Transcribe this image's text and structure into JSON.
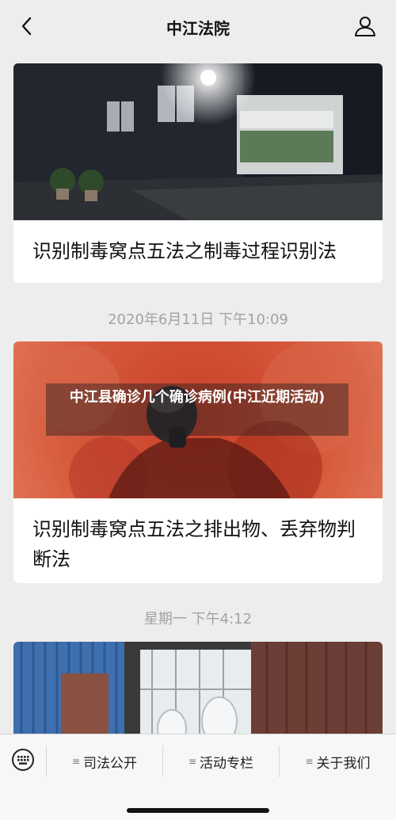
{
  "header": {
    "title": "中江法院"
  },
  "articles": [
    {
      "title": "识别制毒窝点五法之制毒过程识别法"
    },
    {
      "time": "2020年6月11日 下午10:09",
      "title": "识别制毒窝点五法之排出物、丢弃物判断法",
      "overlay": "中江县确诊几个确诊病例(中江近期活动)"
    },
    {
      "time": "星期一 下午4:12"
    }
  ],
  "menu": {
    "items": [
      {
        "label": "司法公开",
        "icon": "list-icon"
      },
      {
        "label": "活动专栏",
        "icon": "list-icon"
      },
      {
        "label": "关于我们",
        "icon": "list-icon"
      }
    ]
  }
}
